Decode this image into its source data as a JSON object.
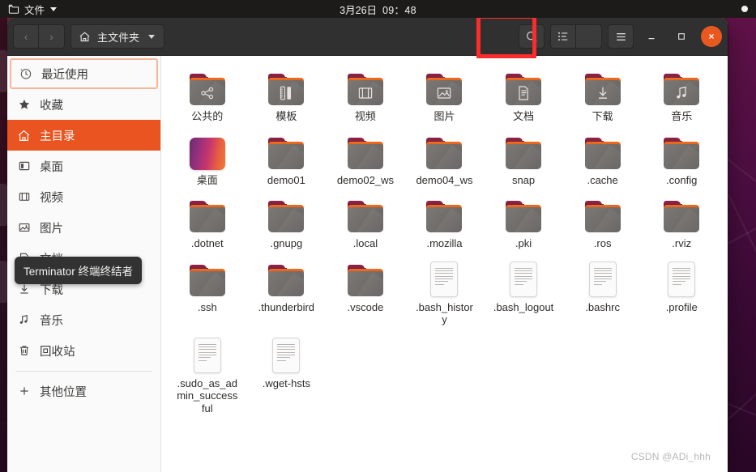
{
  "topbar": {
    "app_menu_label": "文件",
    "app_icon": "folder-icon",
    "date": "3月26日",
    "time": "09：48",
    "indicator_icon": "status-dot-icon"
  },
  "window": {
    "toolbar": {
      "back_label": "‹",
      "forward_label": "›",
      "path_label": "主文件夹",
      "path_home_icon": "home-icon",
      "search_icon": "search-icon",
      "view_list_icon": "view-list-icon",
      "view_dropdown_icon": "chevron-down-icon",
      "menu_icon": "hamburger-menu-icon",
      "minimize_label": "－",
      "maximize_label": "□",
      "close_label": "✕"
    },
    "highlight": {
      "target": "search-button",
      "color": "#fb2c2c"
    }
  },
  "sidebar": {
    "items": [
      {
        "label": "最近使用",
        "icon": "clock-icon",
        "state": "focused"
      },
      {
        "label": "收藏",
        "icon": "star-icon",
        "state": "normal"
      },
      {
        "label": "主目录",
        "icon": "home-icon",
        "state": "selected"
      },
      {
        "label": "桌面",
        "icon": "desktop-icon",
        "state": "normal"
      },
      {
        "label": "视频",
        "icon": "video-icon",
        "state": "normal"
      },
      {
        "label": "图片",
        "icon": "image-icon",
        "state": "normal"
      },
      {
        "label": "文档",
        "icon": "document-icon",
        "state": "normal"
      },
      {
        "label": "下载",
        "icon": "download-icon",
        "state": "normal"
      },
      {
        "label": "音乐",
        "icon": "music-icon",
        "state": "normal"
      },
      {
        "label": "回收站",
        "icon": "trash-icon",
        "state": "normal"
      }
    ],
    "other_locations": {
      "label": "其他位置",
      "icon": "plus-icon"
    },
    "selected_color": "#e95420",
    "focus_color": "#f4b79a"
  },
  "tooltip": {
    "text": "Terminator 终端终结者"
  },
  "files": [
    {
      "name": "公共的",
      "type": "folder",
      "emblem": "share-icon"
    },
    {
      "name": "模板",
      "type": "folder",
      "emblem": "template-icon"
    },
    {
      "name": "视频",
      "type": "folder",
      "emblem": "film-icon"
    },
    {
      "name": "图片",
      "type": "folder",
      "emblem": "image-icon"
    },
    {
      "name": "文档",
      "type": "folder",
      "emblem": "document-icon"
    },
    {
      "name": "下载",
      "type": "folder",
      "emblem": "download-icon"
    },
    {
      "name": "音乐",
      "type": "folder",
      "emblem": "music-icon"
    },
    {
      "name": "桌面",
      "type": "gradient-thumb",
      "emblem": ""
    },
    {
      "name": "demo01",
      "type": "folder",
      "emblem": ""
    },
    {
      "name": "demo02_ws",
      "type": "folder",
      "emblem": ""
    },
    {
      "name": "demo04_ws",
      "type": "folder",
      "emblem": ""
    },
    {
      "name": "snap",
      "type": "folder",
      "emblem": ""
    },
    {
      "name": ".cache",
      "type": "folder",
      "emblem": ""
    },
    {
      "name": ".config",
      "type": "folder",
      "emblem": ""
    },
    {
      "name": ".dotnet",
      "type": "folder",
      "emblem": ""
    },
    {
      "name": ".gnupg",
      "type": "folder",
      "emblem": ""
    },
    {
      "name": ".local",
      "type": "folder",
      "emblem": ""
    },
    {
      "name": ".mozilla",
      "type": "folder",
      "emblem": ""
    },
    {
      "name": ".pki",
      "type": "folder",
      "emblem": ""
    },
    {
      "name": ".ros",
      "type": "folder",
      "emblem": ""
    },
    {
      "name": ".rviz",
      "type": "folder",
      "emblem": ""
    },
    {
      "name": ".ssh",
      "type": "folder",
      "emblem": ""
    },
    {
      "name": ".thunderbird",
      "type": "folder",
      "emblem": ""
    },
    {
      "name": ".vscode",
      "type": "folder",
      "emblem": ""
    },
    {
      "name": ".bash_history",
      "type": "text-file",
      "emblem": ""
    },
    {
      "name": ".bash_logout",
      "type": "text-file",
      "emblem": ""
    },
    {
      "name": ".bashrc",
      "type": "text-file",
      "emblem": ""
    },
    {
      "name": ".profile",
      "type": "text-file",
      "emblem": ""
    },
    {
      "name": ".sudo_as_admin_successful",
      "type": "text-file",
      "emblem": ""
    },
    {
      "name": ".wget-hsts",
      "type": "text-file",
      "emblem": ""
    }
  ],
  "watermark": {
    "text": "CSDN @ADi_hhh"
  }
}
